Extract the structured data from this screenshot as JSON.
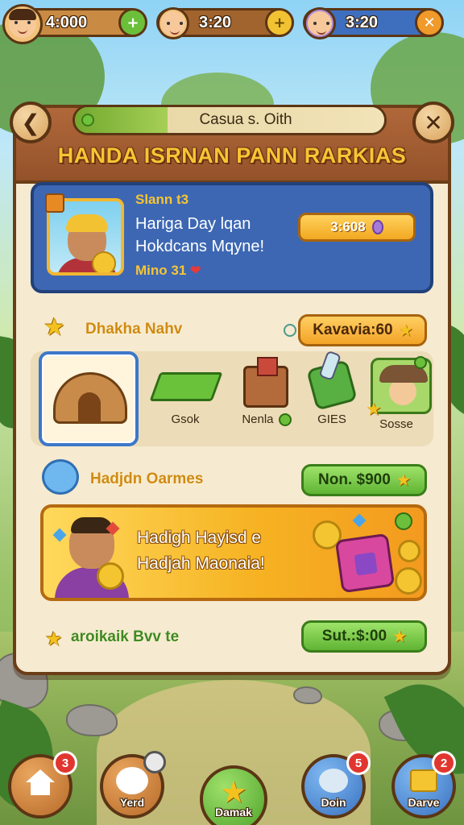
{
  "top_bar": {
    "resources": [
      {
        "value": "4:000",
        "plus_icon": "plus-icon"
      },
      {
        "value": "3:20",
        "plus_icon": "plus-icon"
      },
      {
        "value": "3:20",
        "plus_icon": "plus-icon"
      }
    ]
  },
  "panel": {
    "subtitle": "Casua s. Oith",
    "title": "HANDA ISRNAN PANN RARKIAS"
  },
  "featured": {
    "name": "Slann t3",
    "description": "Hariga Day lqan Hokdcans Mqyne!",
    "meta": "Mino 31",
    "price": "3:608"
  },
  "section1": {
    "label": "Dhakha Nahv",
    "button": "Kavavia:60"
  },
  "items": [
    {
      "label": ""
    },
    {
      "label": "Gsok"
    },
    {
      "label": "Nenla"
    },
    {
      "label": "GIES"
    },
    {
      "label": "Sosse"
    }
  ],
  "section2": {
    "label": "Hadjdn Oarmes",
    "button": "Non. $900"
  },
  "promo": {
    "text": "Hadigh Hayisd e Hadjah Maonaia!"
  },
  "section3": {
    "label": "aroikaik Bvv te",
    "button": "Sut.:$:00"
  },
  "bottom_nav": [
    {
      "label": "",
      "badge": "3"
    },
    {
      "label": "Yerd",
      "badge": ""
    },
    {
      "label": "Damak",
      "badge": ""
    },
    {
      "label": "Doin",
      "badge": "5"
    },
    {
      "label": "Darve",
      "badge": "2"
    }
  ],
  "colors": {
    "header_wood": "#94522a",
    "panel_bg": "#f6ead0",
    "title_gold": "#f7c534",
    "feature_blue": "#3d67b3",
    "button_green": "#5fb433",
    "button_orange": "#f3a327",
    "badge_red": "#e1362f"
  }
}
